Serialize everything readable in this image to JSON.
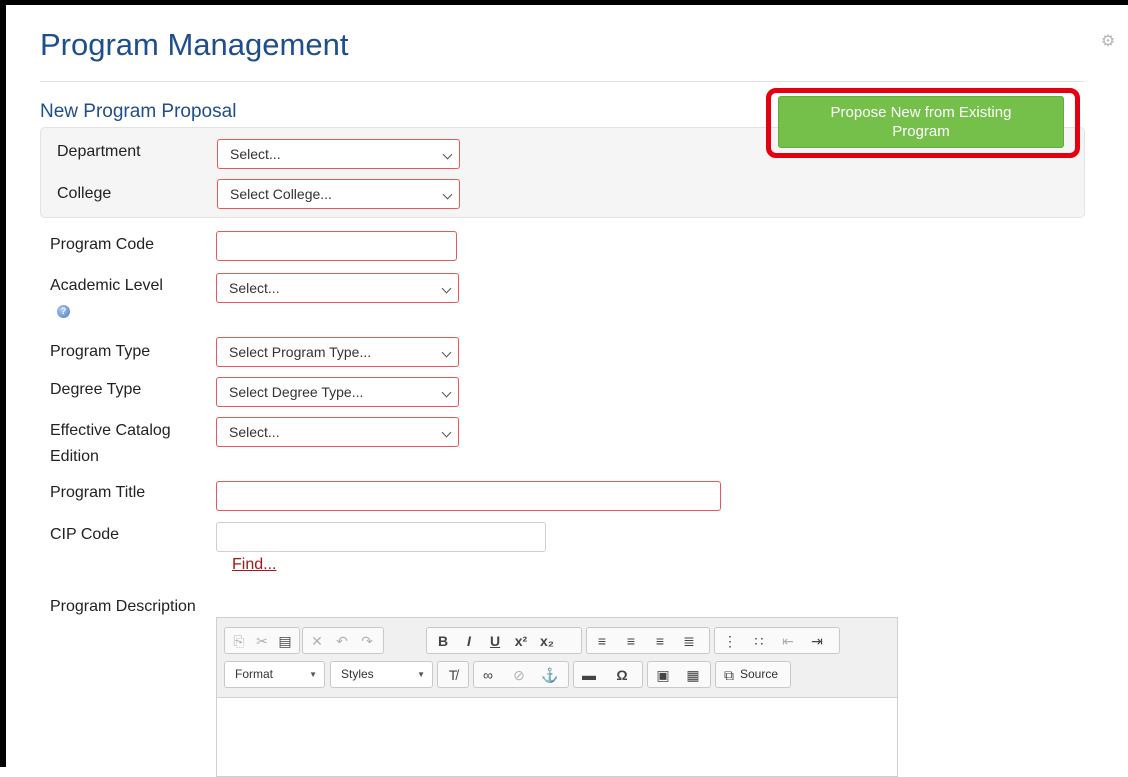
{
  "header": {
    "title": "Program Management",
    "section_title": "New Program Proposal",
    "gear_icon": "gear-icon"
  },
  "actions": {
    "propose_from_existing_line1": "Propose New from Existing",
    "propose_from_existing_line2": "Program",
    "button_color": "#74c04b",
    "highlight_color": "#e3000f"
  },
  "org": {
    "department_label": "Department",
    "department_value": "Select...",
    "college_label": "College",
    "college_value": "Select College..."
  },
  "form": {
    "program_code_label": "Program Code",
    "program_code_value": "",
    "academic_level_label": "Academic Level",
    "academic_level_value": "Select...",
    "program_type_label": "Program Type",
    "program_type_value": "Select Program Type...",
    "degree_type_label": "Degree Type",
    "degree_type_value": "Select Degree Type...",
    "catalog_label_line1": "Effective Catalog",
    "catalog_label_line2": "Edition",
    "catalog_value": "Select...",
    "program_title_label": "Program Title",
    "program_title_value": "",
    "cip_code_label": "CIP Code",
    "cip_code_value": "",
    "find_link": "Find...",
    "description_label": "Program Description"
  },
  "editor": {
    "format_label": "Format",
    "styles_label": "Styles",
    "source_label": "Source"
  }
}
